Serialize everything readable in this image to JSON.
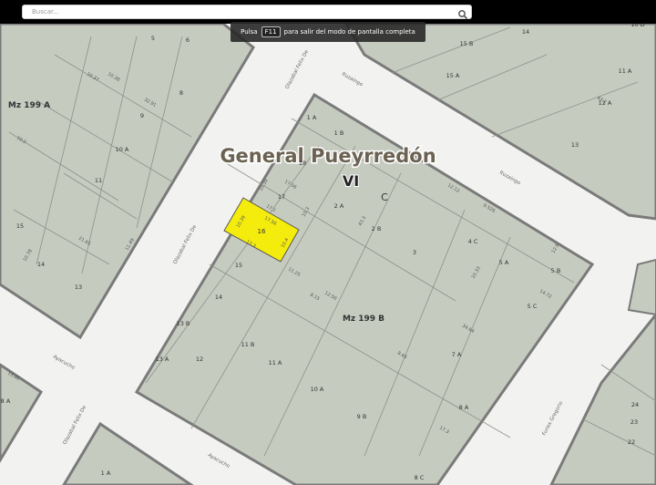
{
  "search": {
    "placeholder": "Buscar..."
  },
  "fullscreen_tip": {
    "before": "Pulsa",
    "key": "F11",
    "after": "para salir del modo de pantalla completa"
  },
  "map": {
    "municipality": "General Pueyrredón",
    "sector": "VI",
    "circ": "C",
    "colors": {
      "land": "#c6cbc0",
      "block_border": "#7a7a7a",
      "highlight": "#f4ec0c",
      "road": "#f2f2f0"
    },
    "blocks": [
      "Mz 199 A",
      "Mz 199 B"
    ],
    "streets": [
      {
        "name": "Olazabal Felix De",
        "id": "olazabal-1"
      },
      {
        "name": "Olazabal Felix De",
        "id": "olazabal-2"
      },
      {
        "name": "Olazabal Felix De",
        "id": "olazabal-3"
      },
      {
        "name": "Ituzaingo",
        "id": "ituzaingo-1"
      },
      {
        "name": "Ituzaingo",
        "id": "ituzaingo-2"
      },
      {
        "name": "Ayacucho",
        "id": "ayacucho-1"
      },
      {
        "name": "Ayacucho",
        "id": "ayacucho-2"
      },
      {
        "name": "Funes Gregorio",
        "id": "funes-1"
      }
    ],
    "highlighted_parcel": {
      "label": "16",
      "dims": [
        "17.56",
        "10.39",
        "17.3",
        "10.4"
      ]
    },
    "parcels_b": [
      "1 A",
      "1 B",
      "2 A",
      "2 B",
      "3",
      "4 C",
      "5 A",
      "5 B",
      "5 C",
      "7 A",
      "8 A",
      "9 B",
      "10 A",
      "11 A",
      "11 B",
      "12",
      "13 A",
      "13 B",
      "14",
      "15",
      "17",
      "18"
    ],
    "parcels_a": [
      "5",
      "6",
      "8",
      "9",
      "10 A",
      "11",
      "13",
      "14",
      "15"
    ],
    "parcels_ne": [
      "11 A",
      "12 A",
      "13",
      "14",
      "15 A",
      "15 B"
    ],
    "parcels_other": [
      "1 A",
      "8 A",
      "10 D",
      "22",
      "23",
      "24",
      "8 C"
    ],
    "measures": [
      "17.56",
      "17.1",
      "10.39",
      "10.3",
      "11.25",
      "12.12",
      "9.526",
      "43.3",
      "12.58",
      "8.15",
      "34.64",
      "12.6",
      "14.72",
      "10.2",
      "10.37",
      "43.2",
      "10.33",
      "8.66",
      "17.3",
      "32.91",
      "10.38",
      "10.78",
      "11.49",
      "21.65",
      "13.86"
    ]
  }
}
